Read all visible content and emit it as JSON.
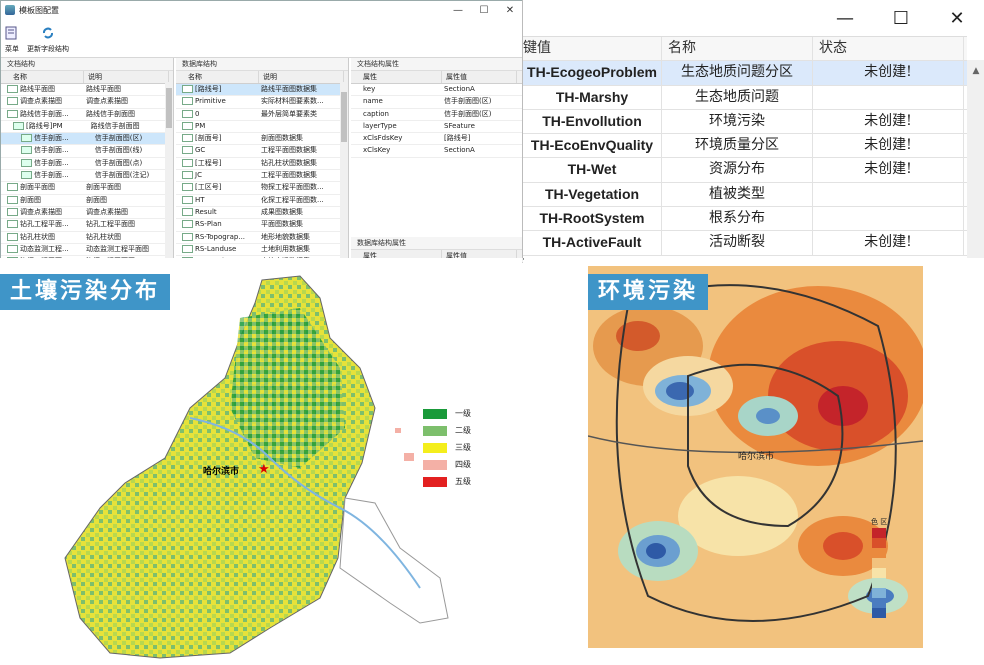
{
  "left_window": {
    "title": "模板图配置",
    "toolbar": [
      {
        "label": "菜单",
        "icon": "menu-icon"
      },
      {
        "label": "更新字段结构",
        "icon": "refresh-icon"
      }
    ],
    "doc_panel": {
      "header": "文档结构",
      "columns": [
        "名称",
        "说明"
      ],
      "rows": [
        {
          "name": "路线平面图",
          "desc": "路线平面图"
        },
        {
          "name": "调查点素描图",
          "desc": "调查点素描图"
        },
        {
          "name": "路线信手剖面...",
          "desc": "路线信手剖面图"
        },
        {
          "name": "[路线号]PM",
          "desc": "路线信手剖面图"
        },
        {
          "name": "信手剖面...",
          "desc": "信手剖面图(区)"
        },
        {
          "name": "信手剖面...",
          "desc": "信手剖面图(线)"
        },
        {
          "name": "信手剖面...",
          "desc": "信手剖面图(点)"
        },
        {
          "name": "信手剖面...",
          "desc": "信手剖面图(注记)"
        },
        {
          "name": "剖面平面图",
          "desc": "剖面平面图"
        },
        {
          "name": "剖面图",
          "desc": "剖面图"
        },
        {
          "name": "调查点素描图",
          "desc": "调查点素描图"
        },
        {
          "name": "钻孔工程平面...",
          "desc": "钻孔工程平面图"
        },
        {
          "name": "钻孔柱状图",
          "desc": "钻孔柱状图"
        },
        {
          "name": "动态监测工程...",
          "desc": "动态监测工程平面图"
        },
        {
          "name": "物探工程平面...",
          "desc": "物探工程平面图"
        },
        {
          "name": "化探工程平面...",
          "desc": "化探工程平面图"
        }
      ]
    },
    "db_panel": {
      "header": "数据库结构",
      "columns": [
        "名称",
        "说明"
      ],
      "rows": [
        {
          "name": "[路线号]",
          "desc": "路线平面图数据集"
        },
        {
          "name": "Primitive",
          "desc": "实际材料图要素数..."
        },
        {
          "name": "0",
          "desc": "最外层简单要素类"
        },
        {
          "name": "PM",
          "desc": ""
        },
        {
          "name": "[剖面号]",
          "desc": "剖面图数据集"
        },
        {
          "name": "GC",
          "desc": "工程平面图数据集"
        },
        {
          "name": "[工程号]",
          "desc": "钻孔柱状图数据集"
        },
        {
          "name": "JC",
          "desc": "工程平面图数据集"
        },
        {
          "name": "[工区号]",
          "desc": "物探工程平面图数..."
        },
        {
          "name": "HT",
          "desc": "化探工程平面图数..."
        },
        {
          "name": "Result",
          "desc": "成果图数据集"
        },
        {
          "name": "RS-Plan",
          "desc": "平面图数据集"
        },
        {
          "name": "RS-Topograp...",
          "desc": "地形地貌数据集"
        },
        {
          "name": "RS-Landuse",
          "desc": "土地利用数据集"
        },
        {
          "name": "RS-LanduseC...",
          "desc": "土地变迁数据集"
        },
        {
          "name": "RS-QuaGeo",
          "desc": "第四纪地质数据集"
        }
      ]
    },
    "prop_panel": {
      "header": "文档结构属性",
      "columns": [
        "属性",
        "属性值"
      ],
      "rows": [
        {
          "key": "key",
          "value": "SectionA"
        },
        {
          "key": "name",
          "value": "信手剖面图(区)"
        },
        {
          "key": "caption",
          "value": "信手剖面图(区)"
        },
        {
          "key": "layerType",
          "value": "SFeature"
        },
        {
          "key": "xClsFdsKey",
          "value": "[路线号]"
        },
        {
          "key": "xClsKey",
          "value": "SectionA"
        }
      ],
      "db_header": "数据库结构属性",
      "db_columns": [
        "属性",
        "属性值"
      ]
    }
  },
  "right_window": {
    "columns": [
      "键值",
      "名称",
      "状态"
    ],
    "rows": [
      {
        "key": "TH-EcogeoProblem",
        "name": "生态地质问题分区",
        "status": "未创建!"
      },
      {
        "key": "TH-Marshy",
        "name": "生态地质问题",
        "status": ""
      },
      {
        "key": "TH-Envollution",
        "name": "环境污染",
        "status": "未创建!"
      },
      {
        "key": "TH-EcoEnvQuality",
        "name": "环境质量分区",
        "status": "未创建!"
      },
      {
        "key": "TH-Wet",
        "name": "资源分布",
        "status": "未创建!"
      },
      {
        "key": "TH-Vegetation",
        "name": "植被类型",
        "status": ""
      },
      {
        "key": "TH-RootSystem",
        "name": "根系分布",
        "status": ""
      },
      {
        "key": "TH-ActiveFault",
        "name": "活动断裂",
        "status": "未创建!"
      }
    ]
  },
  "soil_map": {
    "banner": "土壤污染分布",
    "city_label": "哈尔滨市",
    "legend": [
      {
        "label": "一级",
        "color": "#1a9a3a"
      },
      {
        "label": "二级",
        "color": "#7dbf6c"
      },
      {
        "label": "三级",
        "color": "#f4ee1c"
      },
      {
        "label": "四级",
        "color": "#f4b0a6"
      },
      {
        "label": "五级",
        "color": "#e32020"
      }
    ]
  },
  "env_map": {
    "banner": "环境污染",
    "city_label": "哈尔滨市",
    "legend_title": "色 区"
  }
}
